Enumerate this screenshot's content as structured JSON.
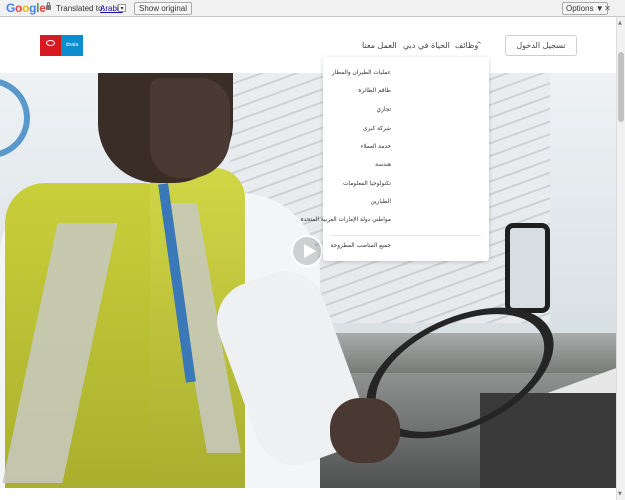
{
  "translate_bar": {
    "brand": "Google",
    "translated_to": "Translated to:",
    "language": "Arabic",
    "dropdown_glyph": "▾",
    "show_original": "Show original",
    "options": "Options ▼",
    "close_glyph": "✕"
  },
  "header": {
    "logo_dnata": "dnata",
    "nav": {
      "work": "العمل معنا",
      "life_in_dubai": "الحياة في دبي",
      "jobs": "وظائف",
      "chevron": "^"
    },
    "login": "تسجيل الدخول"
  },
  "dropdown": {
    "items": [
      "عمليات الطيران والمطار",
      "طاقم الطائرة",
      "تجاري",
      "شركة كبرى",
      "خدمة العملاء",
      "هندسة",
      "تكنولوجيا المعلومات",
      "الطيارين",
      "مواطني دولة الإمارات العربية المتحدة"
    ],
    "all_jobs": "جميع المناصب المطروحة"
  },
  "hero": {
    "play_icon": "play-icon"
  },
  "colors": {
    "emirates_red": "#d71921",
    "dnata_blue": "#0c8dd0",
    "vest_yellow": "#c9cf3a",
    "link_blue": "#1a0dab"
  }
}
